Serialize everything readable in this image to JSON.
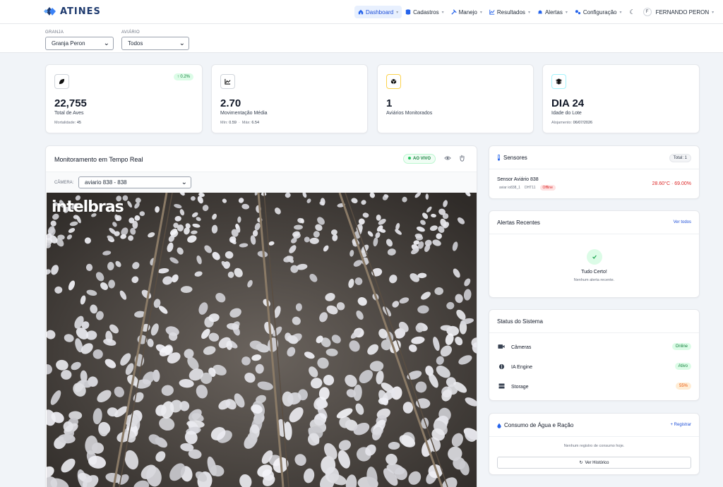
{
  "brand": {
    "name": "ATINES"
  },
  "nav": {
    "items": [
      {
        "label": "Dashboard",
        "icon": "home-icon"
      },
      {
        "label": "Cadastros",
        "icon": "database-icon"
      },
      {
        "label": "Manejo",
        "icon": "tools-icon"
      },
      {
        "label": "Resultados",
        "icon": "chart-icon"
      },
      {
        "label": "Alertas",
        "icon": "bell-icon"
      },
      {
        "label": "Configuração",
        "icon": "cogs-icon"
      }
    ],
    "user": {
      "initial": "F",
      "name": "FERNANDO PERON"
    }
  },
  "filters": {
    "granja": {
      "label": "GRANJA",
      "value": "Granja Peron"
    },
    "aviario": {
      "label": "AVIÁRIO",
      "value": "Todos"
    }
  },
  "stats": [
    {
      "icon": "leaf-icon",
      "value": "22,755",
      "label": "Total de Aves",
      "sub_label": "Mortalidade:",
      "sub_value": "45",
      "trend": "↑ 0.2%"
    },
    {
      "icon": "line-chart-icon",
      "value": "2.70",
      "label": "Movimentação Média",
      "sub_label": "Mín:",
      "sub_value": "0.59",
      "sub_label2": "Máx:",
      "sub_value2": "6.54"
    },
    {
      "icon": "cube-icon",
      "value": "1",
      "label": "Aviários Monitorados"
    },
    {
      "icon": "layers-icon",
      "value": "DIA 24",
      "label": "Idade do Lote",
      "sub_label": "Alojamento:",
      "sub_value": "06/07/2026"
    }
  ],
  "monitor": {
    "title": "Monitoramento em Tempo Real",
    "live": "AO VIVO",
    "camera_label": "CÂMERA:",
    "camera_value": "aviario 838 - 838",
    "overlay_brand": "intelbras"
  },
  "sensors": {
    "title": "Sensores",
    "total": "Total: 1",
    "item": {
      "name": "Sensor Aviário 838",
      "id": "aviar io838_1",
      "type": "DHT11",
      "status": "Offline",
      "reading": "28.60°C · 69.00%"
    }
  },
  "alerts": {
    "title": "Alertas Recentes",
    "link": "Ver todos",
    "ok_title": "Tudo Certo!",
    "ok_sub": "Nenhum alerta recente."
  },
  "system": {
    "title": "Status do Sistema",
    "rows": [
      {
        "icon": "camera-icon",
        "label": "Câmeras",
        "status": "Online"
      },
      {
        "icon": "brain-icon",
        "label": "IA Engine",
        "status": "Ativo"
      },
      {
        "icon": "storage-icon",
        "label": "Storage",
        "status": "55%"
      }
    ]
  },
  "consumption": {
    "title": "Consumo de Água e Ração",
    "link": "+ Registrar",
    "empty": "Nenhum registro de consumo hoje.",
    "history_button": "Ver Histórico"
  },
  "colors": {
    "accent": "#1d4ed8",
    "success": "#15803d",
    "danger": "#dc2626",
    "warning": "#ea580c",
    "background": "#f1f4f8"
  }
}
